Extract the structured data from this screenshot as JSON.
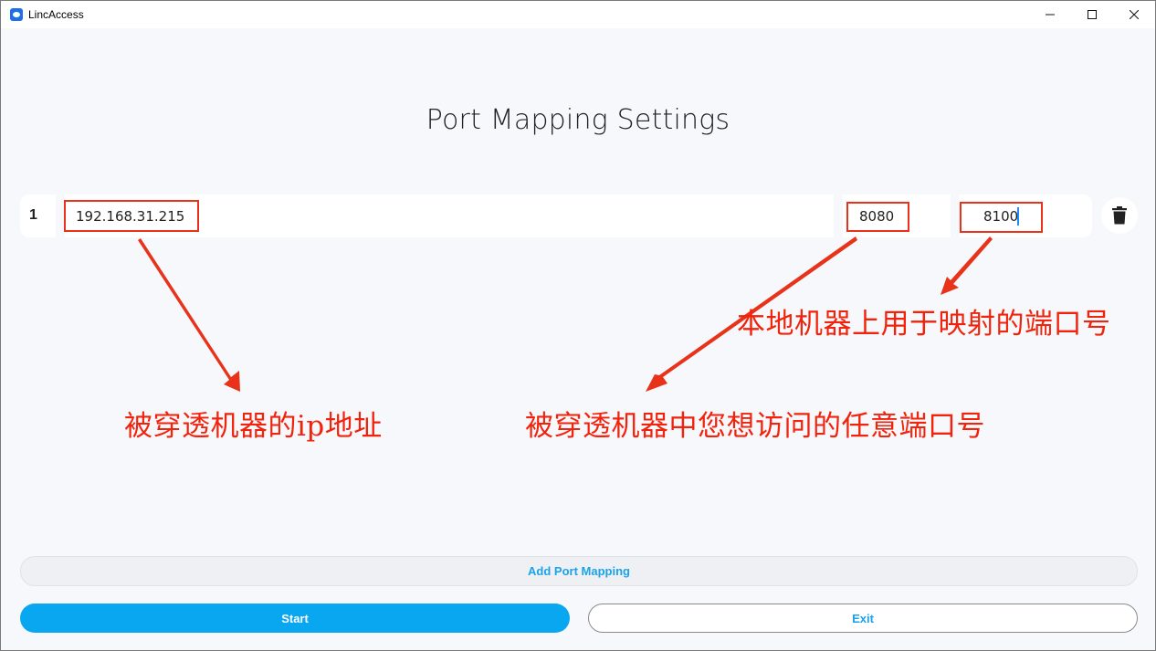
{
  "window": {
    "title": "LincAccess",
    "icon": "lincaccess-app-icon",
    "controls": [
      "minimize-icon",
      "maximize-icon",
      "close-icon"
    ]
  },
  "page_title": "Port Mapping Settings",
  "mapping_rows": [
    {
      "index": "1",
      "ip": "192.168.31.215",
      "remote_port": "8080",
      "local_port": "8100",
      "delete_icon": "trash-icon"
    }
  ],
  "annotations": {
    "ip_note": "被穿透机器的ip地址",
    "remote_port_note": "被穿透机器中您想访问的任意端口号",
    "local_port_note": "本地机器上用于映射的端口号"
  },
  "buttons": {
    "add": "Add Port Mapping",
    "start": "Start",
    "exit": "Exit"
  },
  "colors": {
    "accent": "#08a7f0",
    "link": "#1aa3e8",
    "annotation_red": "#f2230c",
    "background": "#f7f8fb"
  }
}
